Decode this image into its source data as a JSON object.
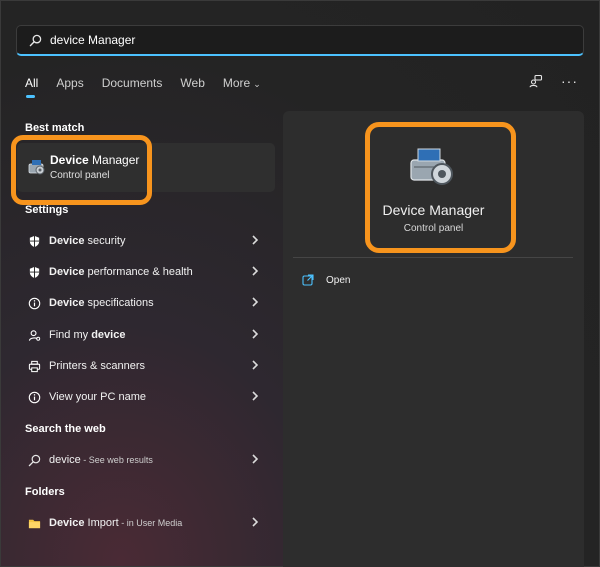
{
  "search": {
    "query": "device Manager"
  },
  "tabs": [
    {
      "label": "All",
      "active": true
    },
    {
      "label": "Apps"
    },
    {
      "label": "Documents"
    },
    {
      "label": "Web"
    },
    {
      "label": "More"
    }
  ],
  "sections": {
    "best_match": "Best match",
    "settings": "Settings",
    "search_web": "Search the web",
    "folders": "Folders"
  },
  "best_match": {
    "title_bold": "Device",
    "title_rest": " Manager",
    "subtitle": "Control panel"
  },
  "settings_items": [
    {
      "bold": "Device",
      "rest": " security",
      "icon": "shield-icon"
    },
    {
      "bold": "Device",
      "rest": " performance & health",
      "icon": "shield-icon"
    },
    {
      "bold": "Device",
      "rest": " specifications",
      "icon": "info-icon"
    },
    {
      "pre": "Find my ",
      "bold": "device",
      "icon": "person-location-icon"
    },
    {
      "pre": "Printers & scanners",
      "icon": "printer-icon"
    },
    {
      "pre": "View your PC name",
      "icon": "info-icon"
    }
  ],
  "web_item": {
    "text": "device",
    "muted": " - See web results"
  },
  "folder_item": {
    "bold": "Device",
    "rest": " Import",
    "muted": " - in User Media"
  },
  "detail": {
    "title": "Device Manager",
    "subtitle": "Control panel",
    "actions": [
      {
        "label": "Open",
        "icon": "open-external-icon"
      }
    ]
  },
  "colors": {
    "accent": "#4cc2ff",
    "highlight": "#f7941d",
    "folder": "#f5c542"
  }
}
